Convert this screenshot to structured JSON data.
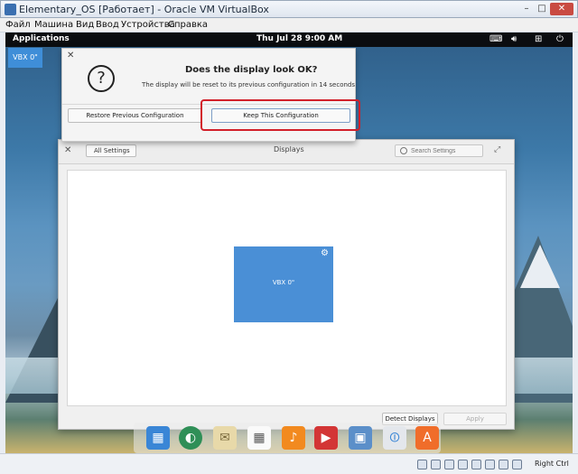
{
  "host_window": {
    "title": "Elementary_OS [Работает] - Oracle VM VirtualBox",
    "menu": [
      "Файл",
      "Машина",
      "Вид",
      "Ввод",
      "Устройства",
      "Справка"
    ],
    "host_key_label": "Right Ctrl"
  },
  "panel": {
    "applications_label": "Applications",
    "clock": "Thu Jul 28   9:00 AM",
    "indicators": [
      "keyboard-icon",
      "volume-icon",
      "network-icon",
      "power-icon"
    ]
  },
  "workspace_tile": {
    "label": "VBX 0\""
  },
  "dialog": {
    "title": "Does the display look OK?",
    "message": "The display will be reset to its previous configuration in 14 seconds",
    "restore_label": "Restore Previous Configuration",
    "keep_label": "Keep This Configuration",
    "highlight_color": "#d2202a"
  },
  "settings": {
    "back_label": "All Settings",
    "title": "Displays",
    "search_placeholder": "Search Settings",
    "monitor_label": "VBX 0\"",
    "monitor_color": "#4a8fd6",
    "detect_label": "Detect Displays",
    "apply_label": "Apply"
  },
  "dock": {
    "items": [
      "multitasking-icon",
      "browser-icon",
      "mail-icon",
      "calendar-icon",
      "music-icon",
      "video-icon",
      "photos-icon",
      "switchboard-icon",
      "appcenter-icon"
    ]
  }
}
